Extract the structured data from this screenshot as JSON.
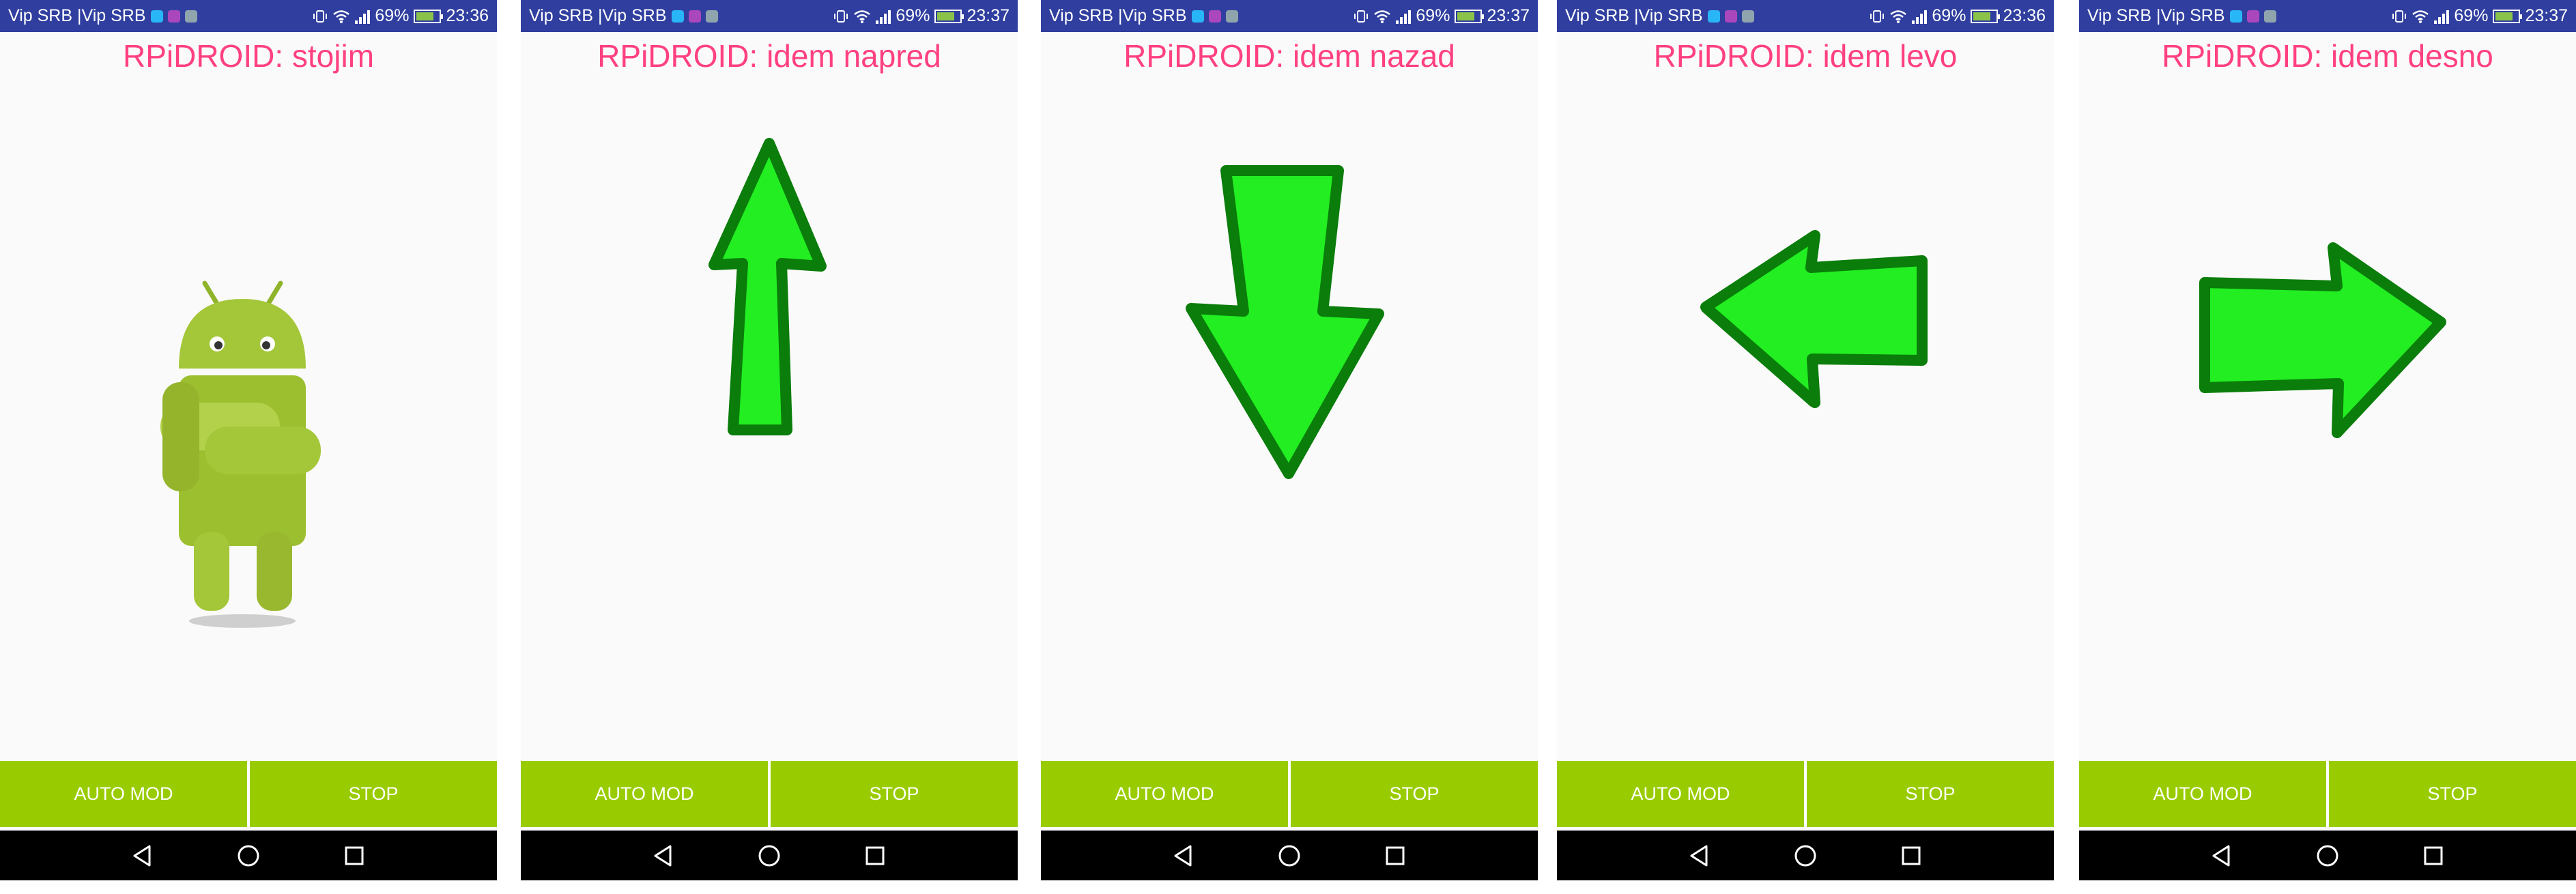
{
  "status_bar": {
    "carrier": "Vip SRB |Vip SRB",
    "battery_percent": "69%",
    "battery_level": 0.69,
    "icons": [
      "notification-icon",
      "vibrate-icon",
      "wifi-icon",
      "signal-icon",
      "battery-icon"
    ]
  },
  "screens": [
    {
      "title": "RPiDROID: stojim",
      "time": "23:36",
      "figure": "android-robot-icon"
    },
    {
      "title": "RPiDROID: idem napred",
      "time": "23:37",
      "figure": "arrow-up-icon"
    },
    {
      "title": "RPiDROID: idem nazad",
      "time": "23:37",
      "figure": "arrow-down-icon"
    },
    {
      "title": "RPiDROID: idem levo",
      "time": "23:36",
      "figure": "arrow-left-icon"
    },
    {
      "title": "RPiDROID: idem desno",
      "time": "23:37",
      "figure": "arrow-right-icon"
    }
  ],
  "buttons": {
    "auto_label": "AUTO MOD",
    "stop_label": "STOP"
  },
  "nav": {
    "icons": [
      "back-icon",
      "home-icon",
      "recents-icon"
    ]
  },
  "colors": {
    "status_bar": "#303f9f",
    "title": "#ff4081",
    "button": "#99cc00",
    "arrow_fill": "#22ee22",
    "arrow_stroke": "#0a7d0a",
    "android": "#a4c639"
  }
}
